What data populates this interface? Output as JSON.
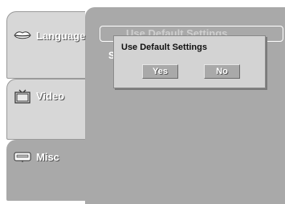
{
  "sidebar": {
    "items": [
      {
        "label": "Language",
        "icon": "lips-icon"
      },
      {
        "label": "Video",
        "icon": "tv-icon"
      },
      {
        "label": "Misc",
        "icon": "keyboard-icon"
      }
    ],
    "selected": "Misc"
  },
  "setting_row": {
    "label": "Use Default Settings",
    "initial": "S"
  },
  "dialog": {
    "title": "Use Default Settings",
    "yes_label": "Yes",
    "no_label": "No"
  },
  "colors": {
    "panel": "#a9a9a9",
    "tab": "#d7d7d7",
    "dialog": "#d3d3d3"
  }
}
